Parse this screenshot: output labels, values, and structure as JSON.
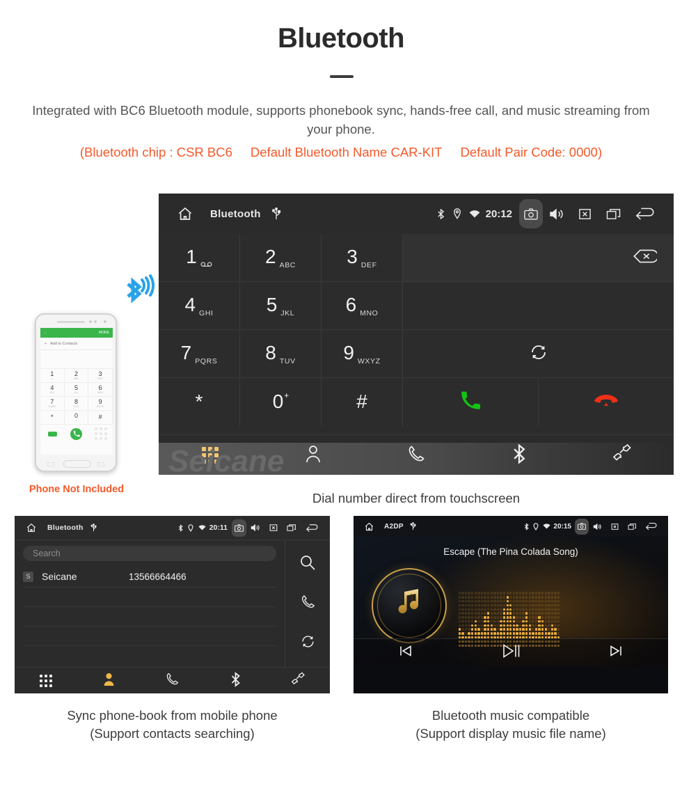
{
  "header": {
    "title": "Bluetooth",
    "lead": "Integrated with BC6 Bluetooth module, supports phonebook sync, hands-free call, and music streaming from your phone.",
    "spec_chip": "(Bluetooth chip : CSR BC6",
    "spec_name": "Default Bluetooth Name CAR-KIT",
    "spec_pair": "Default Pair Code: 0000)",
    "accent_color": "#f4592b"
  },
  "dialer": {
    "status": {
      "home_icon": "home-icon",
      "title": "Bluetooth",
      "usb_icon": "usb-icon",
      "bluetooth_icon": "bluetooth-icon",
      "location_icon": "location-icon",
      "wifi_icon": "wifi-icon",
      "clock": "20:12",
      "camera_icon": "camera-icon",
      "volume_icon": "volume-icon",
      "mute_icon": "mute-icon",
      "recents_icon": "recents-icon",
      "back_icon": "back-icon"
    },
    "keys": [
      {
        "digit": "1",
        "letters": "",
        "sub_icon": "voicemail-icon"
      },
      {
        "digit": "2",
        "letters": "ABC",
        "sub_icon": ""
      },
      {
        "digit": "3",
        "letters": "DEF",
        "sub_icon": ""
      },
      {
        "digit": "4",
        "letters": "GHI",
        "sub_icon": ""
      },
      {
        "digit": "5",
        "letters": "JKL",
        "sub_icon": ""
      },
      {
        "digit": "6",
        "letters": "MNO",
        "sub_icon": ""
      },
      {
        "digit": "7",
        "letters": "PQRS",
        "sub_icon": ""
      },
      {
        "digit": "8",
        "letters": "TUV",
        "sub_icon": ""
      },
      {
        "digit": "9",
        "letters": "WXYZ",
        "sub_icon": ""
      },
      {
        "digit": "*",
        "letters": "",
        "sub_icon": ""
      },
      {
        "digit": "0",
        "letters": "",
        "sub_icon": "plus-sup"
      },
      {
        "digit": "#",
        "letters": "",
        "sub_icon": ""
      }
    ],
    "number_input_value": "",
    "backspace_icon": "backspace-icon",
    "sync_icon": "sync-icon",
    "call_icon": "call-icon",
    "hangup_icon": "hangup-icon",
    "call_color": "#14c414",
    "hangup_color": "#f03018",
    "tabs": [
      {
        "name": "keypad",
        "icon": "keypad-icon",
        "active": true
      },
      {
        "name": "contacts",
        "icon": "contacts-icon",
        "active": false
      },
      {
        "name": "call-log",
        "icon": "phone-icon",
        "active": false
      },
      {
        "name": "bluetooth",
        "icon": "bluetooth-icon",
        "active": false
      },
      {
        "name": "pair",
        "icon": "link-icon",
        "active": false
      }
    ],
    "active_tab_color": "#f0b84a",
    "watermark": "Seicane",
    "caption": "Dial number direct from touchscreen"
  },
  "phone_mockup": {
    "header_back_icon": "back-arrow-icon",
    "header_more": "MORE",
    "add_contacts": "Add to Contacts",
    "plus_icon": "plus-icon",
    "keys": [
      {
        "digit": "1",
        "letters": "∞"
      },
      {
        "digit": "2",
        "letters": "ABC"
      },
      {
        "digit": "3",
        "letters": "DEF"
      },
      {
        "digit": "4",
        "letters": "GHI"
      },
      {
        "digit": "5",
        "letters": "JKL"
      },
      {
        "digit": "6",
        "letters": "MNO"
      },
      {
        "digit": "7",
        "letters": "PQRS"
      },
      {
        "digit": "8",
        "letters": "TUV"
      },
      {
        "digit": "9",
        "letters": "WXYZ"
      },
      {
        "digit": "*",
        "letters": ""
      },
      {
        "digit": "0",
        "letters": "+"
      },
      {
        "digit": "#",
        "letters": ""
      }
    ],
    "call_icon": "call-icon",
    "green_color": "#3ab54a",
    "bluetooth_signal_icon": "bluetooth-signal-icon",
    "bluetooth_signal_color": "#29a3e8",
    "note": "Phone Not Included"
  },
  "phonebook": {
    "status": {
      "home_icon": "home-icon",
      "title": "Bluetooth",
      "usb_icon": "usb-icon",
      "clock": "20:11",
      "camera_icon": "camera-icon",
      "volume_icon": "volume-icon",
      "mute_icon": "mute-icon",
      "recents_icon": "recents-icon",
      "back_icon": "back-icon"
    },
    "search_placeholder": "Search",
    "search_value": "",
    "contacts": [
      {
        "initial": "S",
        "name": "Seicane",
        "number": "13566664466"
      }
    ],
    "rail": [
      {
        "name": "search",
        "icon": "search-icon"
      },
      {
        "name": "call",
        "icon": "phone-icon"
      },
      {
        "name": "sync",
        "icon": "sync-icon"
      }
    ],
    "tabs": [
      {
        "name": "keypad",
        "icon": "keypad-icon",
        "active": false
      },
      {
        "name": "contacts",
        "icon": "contacts-icon",
        "active": true
      },
      {
        "name": "call-log",
        "icon": "phone-icon",
        "active": false
      },
      {
        "name": "bluetooth",
        "icon": "bluetooth-icon",
        "active": false
      },
      {
        "name": "pair",
        "icon": "link-icon",
        "active": false
      }
    ],
    "caption_line1": "Sync phone-book from mobile phone",
    "caption_line2": "(Support contacts searching)"
  },
  "music": {
    "status": {
      "home_icon": "home-icon",
      "title": "A2DP",
      "usb_icon": "usb-icon",
      "clock": "20:15",
      "camera_icon": "camera-icon",
      "volume_icon": "volume-icon",
      "mute_icon": "mute-icon",
      "recents_icon": "recents-icon",
      "back_icon": "back-icon"
    },
    "track_title": "Escape (The Pina Colada Song)",
    "album_icon": "bluetooth-music-note-icon",
    "accent_color": "#e8a93c",
    "controls": [
      {
        "name": "previous",
        "icon": "prev-track-icon"
      },
      {
        "name": "play-pause",
        "icon": "play-pause-icon"
      },
      {
        "name": "next",
        "icon": "next-track-icon"
      }
    ],
    "caption_line1": "Bluetooth music compatible",
    "caption_line2": "(Support display music file name)"
  }
}
